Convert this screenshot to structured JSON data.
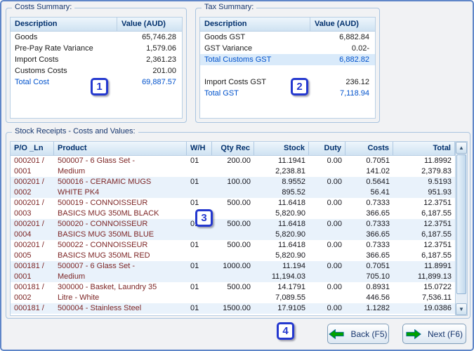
{
  "colors": {
    "header_navy": "#002f6c",
    "total_blue": "#0052cc",
    "product_maroon": "#7d2626",
    "row_shade": "#e9f2fb",
    "highlight_row": "#d9eafa",
    "badge_blue": "#2438cf",
    "arrow_green": "#00a000",
    "groupbox_border": "#a9c4e0"
  },
  "costs_summary": {
    "title": "Costs Summary:",
    "col_description": "Description",
    "col_value": "Value (AUD)",
    "rows": [
      {
        "label": "Goods",
        "value": "65,746.28"
      },
      {
        "label": "Pre-Pay Rate Variance",
        "value": "1,579.06"
      },
      {
        "label": "Import Costs",
        "value": "2,361.23"
      },
      {
        "label": "Customs Costs",
        "value": "201.00"
      },
      {
        "label": "Total Cost",
        "value": "69,887.57",
        "total": true
      }
    ]
  },
  "tax_summary": {
    "title": "Tax Summary:",
    "col_description": "Description",
    "col_value": "Value (AUD)",
    "rows": [
      {
        "label": "Goods GST",
        "value": "6,882.84"
      },
      {
        "label": "GST Variance",
        "value": "0.02-"
      },
      {
        "label": "Total Customs GST",
        "value": "6,882.82",
        "total": true,
        "highlight": true
      },
      {
        "label": "",
        "value": ""
      },
      {
        "label": "Import Costs GST",
        "value": "236.12"
      },
      {
        "label": "Total GST",
        "value": "7,118.94",
        "total": true
      }
    ]
  },
  "stock_receipts": {
    "title": "Stock Receipts - Costs and Values:",
    "headers": [
      "P/O _Ln",
      "Product",
      "W/H",
      "Qty Rec",
      "Stock",
      "Duty",
      "Costs",
      "Total"
    ],
    "lines": [
      {
        "po": "000201 /",
        "product": "500007 - 6 Glass Set -",
        "wh": "01",
        "qty": "200.00",
        "stock": "11.1941",
        "duty": "0.00",
        "costs": "0.7051",
        "total": "11.8992",
        "shade": false
      },
      {
        "po": "0001",
        "product": "Medium",
        "wh": "",
        "qty": "",
        "stock": "2,238.81",
        "duty": "",
        "costs": "141.02",
        "total": "2,379.83",
        "shade": false
      },
      {
        "po": "000201 /",
        "product": "500016 - CERAMIC MUGS",
        "wh": "01",
        "qty": "100.00",
        "stock": "8.9552",
        "duty": "0.00",
        "costs": "0.5641",
        "total": "9.5193",
        "shade": true
      },
      {
        "po": "0002",
        "product": "WHITE PK4",
        "wh": "",
        "qty": "",
        "stock": "895.52",
        "duty": "",
        "costs": "56.41",
        "total": "951.93",
        "shade": true
      },
      {
        "po": "000201 /",
        "product": "500019 - CONNOISSEUR",
        "wh": "01",
        "qty": "500.00",
        "stock": "11.6418",
        "duty": "0.00",
        "costs": "0.7333",
        "total": "12.3751",
        "shade": false
      },
      {
        "po": "0003",
        "product": "BASICS MUG 350ML BLACK",
        "wh": "",
        "qty": "",
        "stock": "5,820.90",
        "duty": "",
        "costs": "366.65",
        "total": "6,187.55",
        "shade": false
      },
      {
        "po": "000201 /",
        "product": "500020 - CONNOISSEUR",
        "wh": "01",
        "qty": "500.00",
        "stock": "11.6418",
        "duty": "0.00",
        "costs": "0.7333",
        "total": "12.3751",
        "shade": true
      },
      {
        "po": "0004",
        "product": "BASICS MUG 350ML BLUE",
        "wh": "",
        "qty": "",
        "stock": "5,820.90",
        "duty": "",
        "costs": "366.65",
        "total": "6,187.55",
        "shade": true
      },
      {
        "po": "000201 /",
        "product": "500022 - CONNOISSEUR",
        "wh": "01",
        "qty": "500.00",
        "stock": "11.6418",
        "duty": "0.00",
        "costs": "0.7333",
        "total": "12.3751",
        "shade": false
      },
      {
        "po": "0005",
        "product": "BASICS MUG 350ML RED",
        "wh": "",
        "qty": "",
        "stock": "5,820.90",
        "duty": "",
        "costs": "366.65",
        "total": "6,187.55",
        "shade": false
      },
      {
        "po": "000181 /",
        "product": "500007 - 6 Glass Set -",
        "wh": "01",
        "qty": "1000.00",
        "stock": "11.194",
        "duty": "0.00",
        "costs": "0.7051",
        "total": "11.8991",
        "shade": true
      },
      {
        "po": "0001",
        "product": "Medium",
        "wh": "",
        "qty": "",
        "stock": "11,194.03",
        "duty": "",
        "costs": "705.10",
        "total": "11,899.13",
        "shade": true
      },
      {
        "po": "000181 /",
        "product": "300000 - Basket, Laundry 35",
        "wh": "01",
        "qty": "500.00",
        "stock": "14.1791",
        "duty": "0.00",
        "costs": "0.8931",
        "total": "15.0722",
        "shade": false
      },
      {
        "po": "0002",
        "product": "Litre - White",
        "wh": "",
        "qty": "",
        "stock": "7,089.55",
        "duty": "",
        "costs": "446.56",
        "total": "7,536.11",
        "shade": false
      },
      {
        "po": "000181 /",
        "product": "500004 - Stainless Steel",
        "wh": "01",
        "qty": "1500.00",
        "stock": "17.9105",
        "duty": "0.00",
        "costs": "1.1282",
        "total": "19.0386",
        "shade": true
      }
    ]
  },
  "badges": {
    "b1": "1",
    "b2": "2",
    "b3": "3",
    "b4": "4"
  },
  "buttons": {
    "back": "Back (F5)",
    "next": "Next (F6)"
  },
  "scrollbar": {
    "up": "▲",
    "down": "▼"
  }
}
